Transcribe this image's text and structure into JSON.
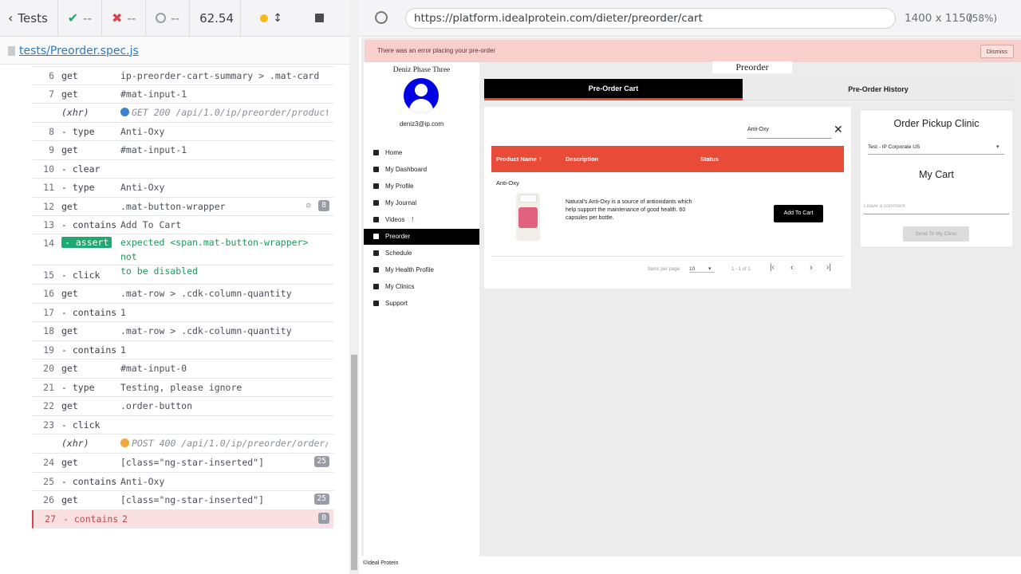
{
  "runner": {
    "back_label": "Tests",
    "passed": "--",
    "failed": "--",
    "pending": "--",
    "duration": "62.54",
    "spec_file": "tests/Preorder.spec.js",
    "viewport": "1400 x 1150",
    "zoom": "(58%)",
    "url": "https://platform.idealprotein.com/dieter/preorder/cart",
    "colors": {
      "passed": "#1fa971",
      "failed": "#d64550",
      "warn": "#f3a63b",
      "error_row": "#fbe0e2"
    }
  },
  "commands": [
    {
      "num": "6",
      "name": "get",
      "arg": "ip-preorder-cart-summary > .mat-card"
    },
    {
      "num": "7",
      "name": "get",
      "arg": "#mat-input-1"
    },
    {
      "num": "",
      "name": "(xhr)",
      "arg": "GET 200 /api/1.0/ip/preorder/product...",
      "xhr": true,
      "dot": "#3b82d6"
    },
    {
      "num": "8",
      "name": "- type",
      "arg": "Anti-Oxy"
    },
    {
      "num": "9",
      "name": "get",
      "arg": "#mat-input-1"
    },
    {
      "num": "10",
      "name": "- clear",
      "arg": ""
    },
    {
      "num": "11",
      "name": "- type",
      "arg": "Anti-Oxy"
    },
    {
      "num": "12",
      "name": "get",
      "arg": ".mat-button-wrapper",
      "badge": "8"
    },
    {
      "num": "13",
      "name": "- contains",
      "arg": "Add To Cart"
    },
    {
      "num": "14",
      "name": "- assert",
      "arg": "expected <span.mat-button-wrapper> not",
      "arg2": "to be disabled",
      "assert": true
    },
    {
      "num": "15",
      "name": "- click",
      "arg": ""
    },
    {
      "num": "16",
      "name": "get",
      "arg": ".mat-row > .cdk-column-quantity"
    },
    {
      "num": "17",
      "name": "- contains",
      "arg": "1"
    },
    {
      "num": "18",
      "name": "get",
      "arg": ".mat-row > .cdk-column-quantity"
    },
    {
      "num": "19",
      "name": "- contains",
      "arg": "1"
    },
    {
      "num": "20",
      "name": "get",
      "arg": "#mat-input-0"
    },
    {
      "num": "21",
      "name": "- type",
      "arg": "Testing, please ignore"
    },
    {
      "num": "22",
      "name": "get",
      "arg": ".order-button"
    },
    {
      "num": "23",
      "name": "- click",
      "arg": ""
    },
    {
      "num": "",
      "name": "(xhr)",
      "arg": "POST 400 /api/1.0/ip/preorder/order/...",
      "xhr": true,
      "dot": "#f3a63b"
    },
    {
      "num": "24",
      "name": "get",
      "arg": "[class=\"ng-star-inserted\"]",
      "badge": "25"
    },
    {
      "num": "25",
      "name": "- contains",
      "arg": "Anti-Oxy"
    },
    {
      "num": "26",
      "name": "get",
      "arg": "[class=\"ng-star-inserted\"]",
      "badge": "25"
    },
    {
      "num": "27",
      "name": "- contains",
      "arg": "2",
      "badge": "0",
      "error": true
    }
  ],
  "app": {
    "error_banner": "There was an error placing your pre-order",
    "dismiss": "Dismiss",
    "page_title": "Preorder",
    "user_name": "Deniz Phase Three",
    "user_email": "deniz3@ip.com",
    "nav": [
      "Home",
      "My Dashboard",
      "My Profile",
      "My Journal",
      "Videos",
      "Preorder",
      "Schedule",
      "My Health Profile",
      "My Clinics",
      "Support"
    ],
    "active_nav": "Preorder",
    "tabs": [
      "Pre-Order Cart",
      "Pre-Order History"
    ],
    "search_value": "Anti-Oxy",
    "table_headers": [
      "Product Name",
      "Description",
      "Status"
    ],
    "product": {
      "name": "Anti-Oxy",
      "description": "Natural's Anti-Oxy is a source of antioxidants which help support the maintenance of good health. 60 capsules per bottle.",
      "button": "Add To Cart"
    },
    "paginator": {
      "label": "Items per page:",
      "size": "10",
      "range": "1 - 1 of 1"
    },
    "pickup_title": "Order Pickup Clinic",
    "clinic": "Test - IP Corporate US",
    "cart_title": "My Cart",
    "comment_placeholder": "Leave a comment",
    "send_button": "Send To My Clinic",
    "footer": "©Ideal Protein",
    "accent": "#e84b37"
  }
}
